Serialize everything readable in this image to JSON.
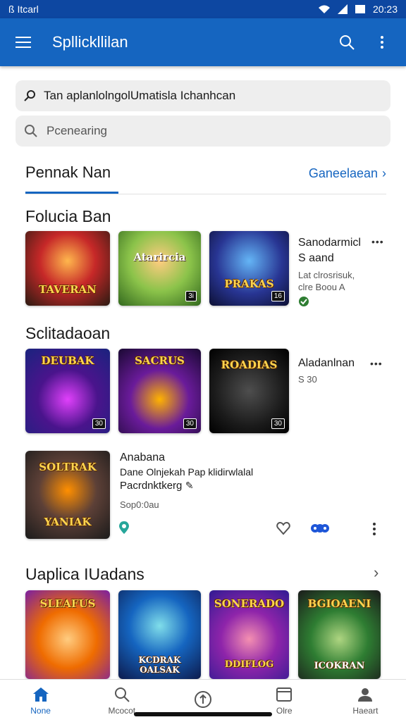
{
  "status": {
    "left": "ß Itcarl",
    "time": "20:23"
  },
  "appbar": {
    "title": "Spllickllilan",
    "menu_icon": "menu-icon",
    "search_icon": "search-icon",
    "more_icon": "more-vert-icon"
  },
  "search_primary": {
    "value": "Tan aplanlolngolUmatisla Ichanhcan"
  },
  "search_secondary": {
    "placeholder": "Pcenearing"
  },
  "tab": {
    "title": "Pennak Nan",
    "link": "Ganeelaean"
  },
  "section1": {
    "title": "Folucia Ban",
    "thumbs": [
      {
        "label": "TAVERAN",
        "badge": ""
      },
      {
        "label": "Atarircia",
        "badge": "3i"
      },
      {
        "label": "PRAKAS",
        "badge": "16"
      }
    ],
    "meta_title": "Sanodarmicl S aand",
    "meta_sub": "Lat clrosrisuk, clre Boou A"
  },
  "section2": {
    "title": "Sclitadaoan",
    "thumbs": [
      {
        "label": "DEUBAK",
        "badge": "30"
      },
      {
        "label": "SACRUS",
        "badge": "30"
      },
      {
        "label": "ROADIAS",
        "badge": "30"
      }
    ],
    "meta_title": "Aladanlnan",
    "meta_sub": "S 30"
  },
  "feature": {
    "label_top": "SOLTRAK",
    "label_bottom": "YANIAK",
    "title": "Anabana",
    "line1": "Dane Olnjekah Pap klidirwlalal",
    "line2": "Pacrdnktkerg",
    "date": "Sop0:0au"
  },
  "section3": {
    "title": "Uaplica IUadans",
    "thumbs": [
      {
        "label": "SLEAFUS",
        "bottom": ""
      },
      {
        "label": "",
        "bottom": "KCDRAK OALSAK"
      },
      {
        "label": "SONERADO",
        "bottom": "DDIFLOG"
      },
      {
        "label": "BGIOAENI",
        "bottom": "ICOKRAN"
      }
    ]
  },
  "nav": [
    {
      "label": "None",
      "icon": "home-icon"
    },
    {
      "label": "Mcocot",
      "icon": "search-icon"
    },
    {
      "label": "",
      "icon": "upload-icon"
    },
    {
      "label": "Olre",
      "icon": "library-icon"
    },
    {
      "label": "Haeart",
      "icon": "profile-icon"
    }
  ],
  "colors": {
    "appbar": "#1565c0",
    "statusbar": "#0d47a1",
    "accent": "#1565c0"
  }
}
